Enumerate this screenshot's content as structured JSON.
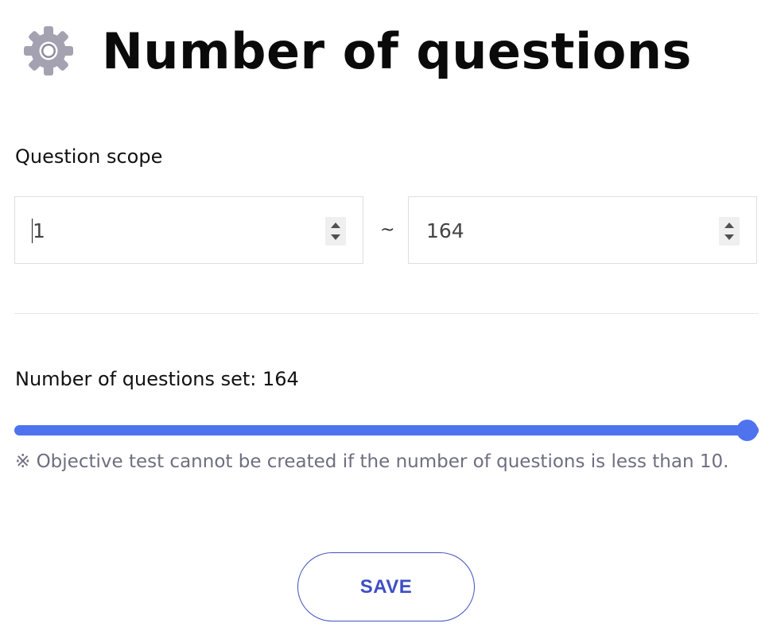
{
  "header": {
    "icon": "gear-icon",
    "icon_color": "#a4a1b1",
    "title": "Number of questions"
  },
  "scope": {
    "label": "Question scope",
    "from_value": "1",
    "separator": "~",
    "to_value": "164"
  },
  "count": {
    "label": "Number of questions set: 164",
    "slider_value": 164,
    "slider_min": 1,
    "slider_max": 164,
    "accent_color": "#4f73ef"
  },
  "note": "※ Objective test cannot be created if the number of questions is less than 10.",
  "actions": {
    "save_label": "SAVE",
    "save_color": "#3e4ec5"
  }
}
